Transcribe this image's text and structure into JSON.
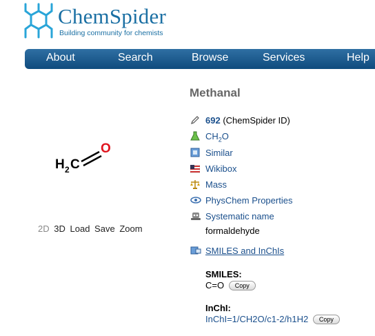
{
  "header": {
    "brand": "ChemSpider",
    "tagline": "Building community for chemists"
  },
  "nav": {
    "items": [
      "About",
      "Search",
      "Browse",
      "Services",
      "Help"
    ]
  },
  "compound": {
    "title": "Methanal",
    "structure": {
      "atom_left": "H",
      "atom_sub": "2",
      "atom_c": "C",
      "atom_o": "O"
    }
  },
  "view_controls": {
    "d2": "2D",
    "d3": "3D",
    "load": "Load",
    "save": "Save",
    "zoom": "Zoom"
  },
  "info": {
    "id_value": "692",
    "id_label": "(ChemSpider ID)",
    "formula_main": "CH",
    "formula_sub": "2",
    "formula_end": "O",
    "similar": "Similar",
    "wikibox": "Wikibox",
    "mass": "Mass",
    "physchem": "PhysChem Properties",
    "systematic_name_label": "Systematic name",
    "systematic_name_value": "formaldehyde",
    "smiles_inchi_link": "SMILES and InChIs",
    "smiles_label": "SMILES:",
    "smiles_value": "C=O",
    "inchi_label": "InChI:",
    "inchi_value": "InChI=1/CH2O/c1-2/h1H2",
    "copy_label": "Copy"
  },
  "icons": {
    "id": "pencil-icon",
    "formula": "flask-icon",
    "similar": "similar-icon",
    "wikibox": "flag-icon",
    "mass": "scales-icon",
    "physchem": "physchem-icon",
    "systematic": "robot-icon",
    "smiles": "smiles-icon"
  },
  "colors": {
    "brand": "#1a6fa3",
    "nav": "#0f4b7d",
    "link": "#1a4f8c",
    "oxygen": "#e0141e"
  }
}
